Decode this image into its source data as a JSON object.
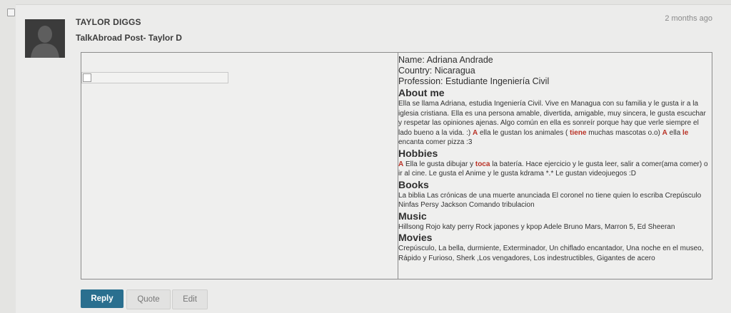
{
  "post": {
    "author": "TAYLOR DIGGS",
    "title": "TalkAbroad Post- Taylor D",
    "timestamp": "2 months ago",
    "avatar_icon": "default-user-silhouette"
  },
  "profile": {
    "name_line": "Name: Adriana Andrade",
    "country_line": "Country: Nicaragua",
    "profession_line": "Profession: Estudiante Ingeniería Civil",
    "about_heading": "About me",
    "about_p1": "Ella se llama Adriana, estudia Ingeniería Civil. Vive en Managua con su familia y le gusta ir a la iglesia cristiana. Ella es una persona amable, divertida, amigable, muy sincera, le gusta escuchar y respetar las opiniones ajenas. Algo común en ella es sonreír porque hay que verle siempre el lado bueno a la vida. :) ",
    "about_mark1": "A",
    "about_p2": " ella le gustan los animales ( ",
    "about_mark2": "tiene",
    "about_p3": " muchas mascotas o.o) ",
    "about_mark3": "A",
    "about_p4": " ella ",
    "about_mark4": "le",
    "about_p5": " encanta comer pizza :3",
    "hobbies_heading": "Hobbies",
    "hobbies_mark1": "A",
    "hobbies_p1": "  Ella le gusta dibujar y ",
    "hobbies_mark2": "toca",
    "hobbies_p2": " la batería. Hace ejercicio y le gusta leer, salir a comer(ama comer) o ir al cine. Le gusta el Anime y le gusta kdrama *.* Le gustan videojuegos :D",
    "books_heading": "Books",
    "books_text": "La biblia Las crónicas de una muerte anunciada El coronel no tiene quien lo escriba Crepúsculo Ninfas Persy Jackson Comando tribulacion",
    "music_heading": "Music",
    "music_text": "Hillsong Rojo katy perry Rock japones y kpop Adele Bruno Mars, Marron 5, Ed Sheeran",
    "movies_heading": "Movies",
    "movies_text": "Crepúsculo, La bella, durmiente, Exterminador, Un chiflado encantador, Una noche en el museo, Rápido y Furioso, Sherk ,Los vengadores, Los indestructibles, Gigantes de acero"
  },
  "actions": {
    "reply_label": "Reply",
    "quote_label": "Quote",
    "edit_label": "Edit"
  },
  "colors": {
    "reply_button": "#2a6f8f",
    "correction_red": "#b93226"
  }
}
